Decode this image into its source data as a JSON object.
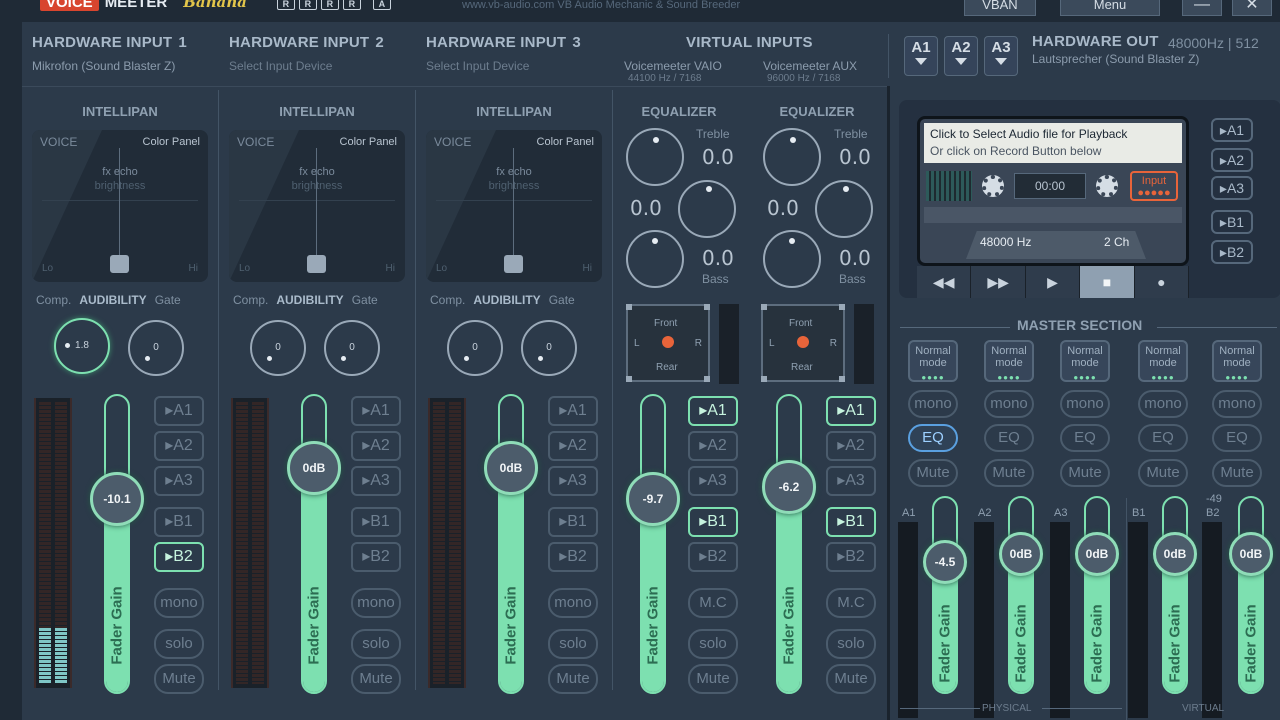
{
  "app": {
    "logo_voice": "VOICE",
    "logo_meeter": "MEETER",
    "logo_banana": "Banana",
    "r_buttons": [
      "R",
      "R",
      "R",
      "R",
      "A"
    ],
    "subtitle_center": "www.vb-audio.com  VB  Audio Mechanic & Sound Breeder",
    "vban_label": "VBAN",
    "menu_label": "Menu",
    "minimize_label": "—",
    "close_label": "✕"
  },
  "inputs": [
    {
      "title": "HARDWARE INPUT",
      "num": "1",
      "device": "Mikrofon (Sound Blaster Z)",
      "fader": "-10.1",
      "comp": "1.8",
      "gate": "0",
      "b2_on": true,
      "fill": 0.62
    },
    {
      "title": "HARDWARE INPUT",
      "num": "2",
      "device": "Select Input Device",
      "fader": "0dB",
      "comp": "0",
      "gate": "0",
      "b2_on": false,
      "fill": 0.78
    },
    {
      "title": "HARDWARE INPUT",
      "num": "3",
      "device": "Select Input Device",
      "fader": "0dB",
      "comp": "0",
      "gate": "0",
      "b2_on": false,
      "fill": 0.78
    }
  ],
  "strip_common": {
    "intellipan": "INTELLIPAN",
    "voice": "VOICE",
    "color_panel": "Color Panel",
    "fx_echo": "fx echo",
    "brightness": "brightness",
    "lo": "Lo",
    "hi": "Hi",
    "comp": "Comp.",
    "audibility": "AUDIBILITY",
    "gate": "Gate",
    "fader_gain": "Fader Gain",
    "a1": "A1",
    "a2": "A2",
    "a3": "A3",
    "b1": "B1",
    "b2": "B2",
    "mono": "mono",
    "solo": "solo",
    "mute": "Mute",
    "mc": "M.C"
  },
  "virtual": {
    "title": "VIRTUAL INPUTS",
    "strips": [
      {
        "name": "Voicemeeter VAIO",
        "rate": "44100 Hz / 7168",
        "fader": "-9.7",
        "fill": 0.64
      },
      {
        "name": "Voicemeeter AUX",
        "rate": "96000 Hz / 7168",
        "fader": "-6.2",
        "fill": 0.68
      }
    ],
    "equalizer": "EQUALIZER",
    "treble": "Treble",
    "bass": "Bass",
    "eq_val": "0.0",
    "front": "Front",
    "rear": "Rear",
    "l": "L",
    "r": "R"
  },
  "hwout": {
    "buttons": [
      "A1",
      "A2",
      "A3"
    ],
    "title": "HARDWARE OUT",
    "rate": "48000Hz | 512",
    "device": "Lautsprecher (Sound Blaster Z)"
  },
  "recorder": {
    "line1": "Click to Select Audio file for Playback",
    "line2": "Or click on Record Button below",
    "time": "00:00",
    "input": "Input",
    "rate": "48000 Hz",
    "channels": "2 Ch",
    "bus_buttons": [
      "A1",
      "A2",
      "A3",
      "B1",
      "B2"
    ],
    "rewind": "◀◀",
    "ffwd": "▶▶",
    "play": "▶",
    "stop": "■",
    "rec": "●"
  },
  "master": {
    "title": "MASTER SECTION",
    "mode_line1": "Normal",
    "mode_line2": "mode",
    "mono": "mono",
    "eq": "EQ",
    "mute": "Mute",
    "fader_gain": "Fader Gain",
    "physical": "PHYSICAL",
    "virtual": "VIRTUAL",
    "buses": [
      {
        "label": "A1",
        "fader": "-4.5",
        "eq_on": true,
        "peak": ""
      },
      {
        "label": "A2",
        "fader": "0dB",
        "eq_on": false,
        "peak": ""
      },
      {
        "label": "A3",
        "fader": "0dB",
        "eq_on": false,
        "peak": ""
      },
      {
        "label": "B1",
        "fader": "0dB",
        "eq_on": false,
        "peak": ""
      },
      {
        "label": "B2",
        "fader": "0dB",
        "eq_on": false,
        "peak": "-49"
      }
    ]
  }
}
